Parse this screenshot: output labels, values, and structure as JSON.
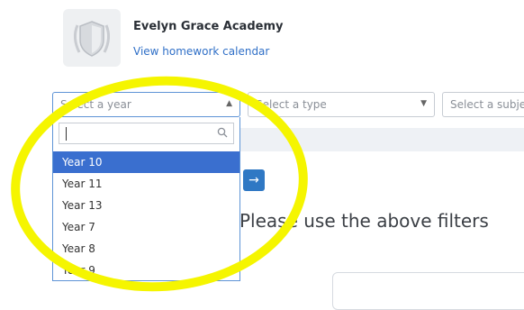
{
  "header": {
    "school_name": "Evelyn Grace Academy",
    "calendar_link": "View homework calendar",
    "logo_icon": "shield-crest-logo"
  },
  "filters": {
    "year": {
      "placeholder": "Select a year",
      "open": true,
      "arrow": "▲"
    },
    "type": {
      "placeholder": "Select a type",
      "arrow": "▼"
    },
    "subject": {
      "placeholder": "Select a subject"
    }
  },
  "year_dropdown": {
    "search_value": "",
    "search_icon": "search-icon",
    "options": [
      "Year 10",
      "Year 11",
      "Year 13",
      "Year 7",
      "Year 8",
      "Year 9"
    ],
    "highlighted": "Year 10"
  },
  "go_button": {
    "icon": "arrow-right-icon",
    "glyph": "→"
  },
  "main": {
    "message": "Please use the above filters"
  },
  "annotation": {
    "shape": "ellipse",
    "color": "#f5f500"
  },
  "colors": {
    "accent": "#2f78c4",
    "highlight": "#3a6fcf",
    "link": "#2f6fc7",
    "focus_border": "#5e94d6"
  }
}
